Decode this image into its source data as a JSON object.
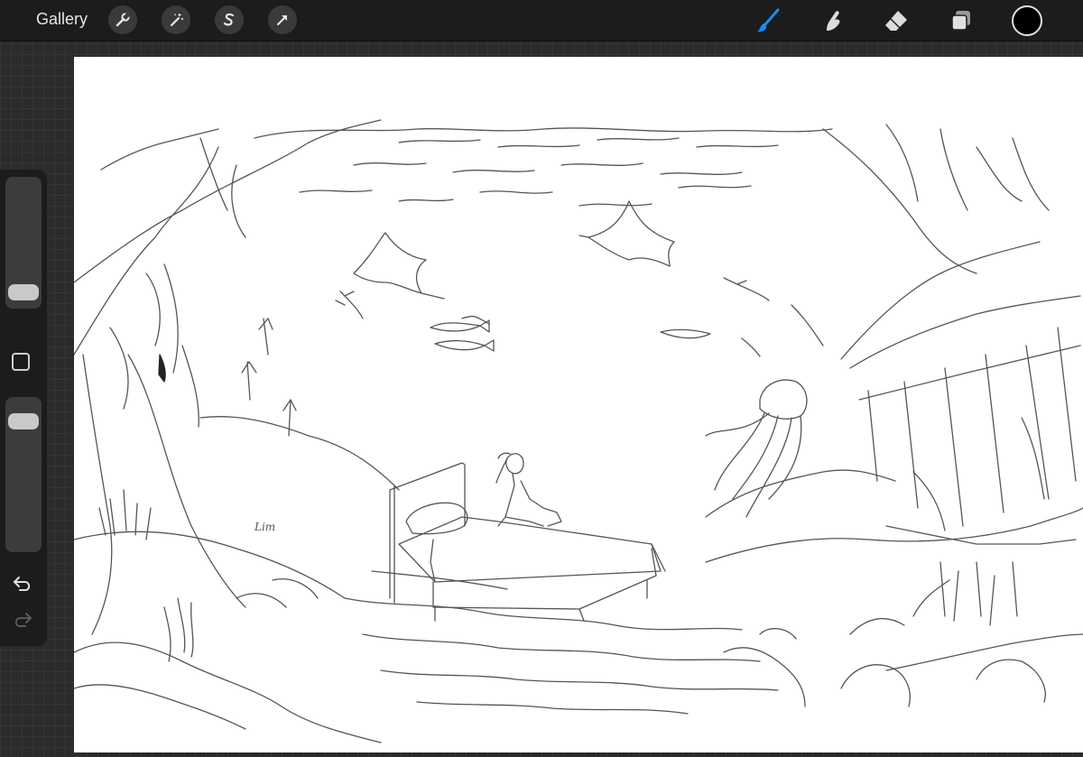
{
  "toolbar": {
    "gallery_label": "Gallery",
    "left_tools": [
      {
        "name": "actions",
        "icon": "wrench-icon"
      },
      {
        "name": "adjustments",
        "icon": "magic-wand-icon"
      },
      {
        "name": "selection",
        "icon": "selection-s-icon"
      },
      {
        "name": "transform",
        "icon": "arrow-cursor-icon"
      }
    ],
    "right_tools": [
      {
        "name": "brush",
        "icon": "paintbrush-icon",
        "active": true
      },
      {
        "name": "smudge",
        "icon": "smudge-finger-icon",
        "active": false
      },
      {
        "name": "eraser",
        "icon": "eraser-icon",
        "active": false
      },
      {
        "name": "layers",
        "icon": "layers-icon",
        "active": false
      }
    ],
    "active_color": "#000000",
    "accent_color": "#1b8cf2"
  },
  "sidebar": {
    "brush_size_level": 0.05,
    "opacity_level": 0.9,
    "modify_icon": "square-icon",
    "undo_icon": "undo-arrow-icon",
    "redo_icon": "redo-arrow-icon"
  },
  "canvas": {
    "background": "#ffffff",
    "artwork": "pencil-line-drawing",
    "signature_text": "Lim"
  }
}
